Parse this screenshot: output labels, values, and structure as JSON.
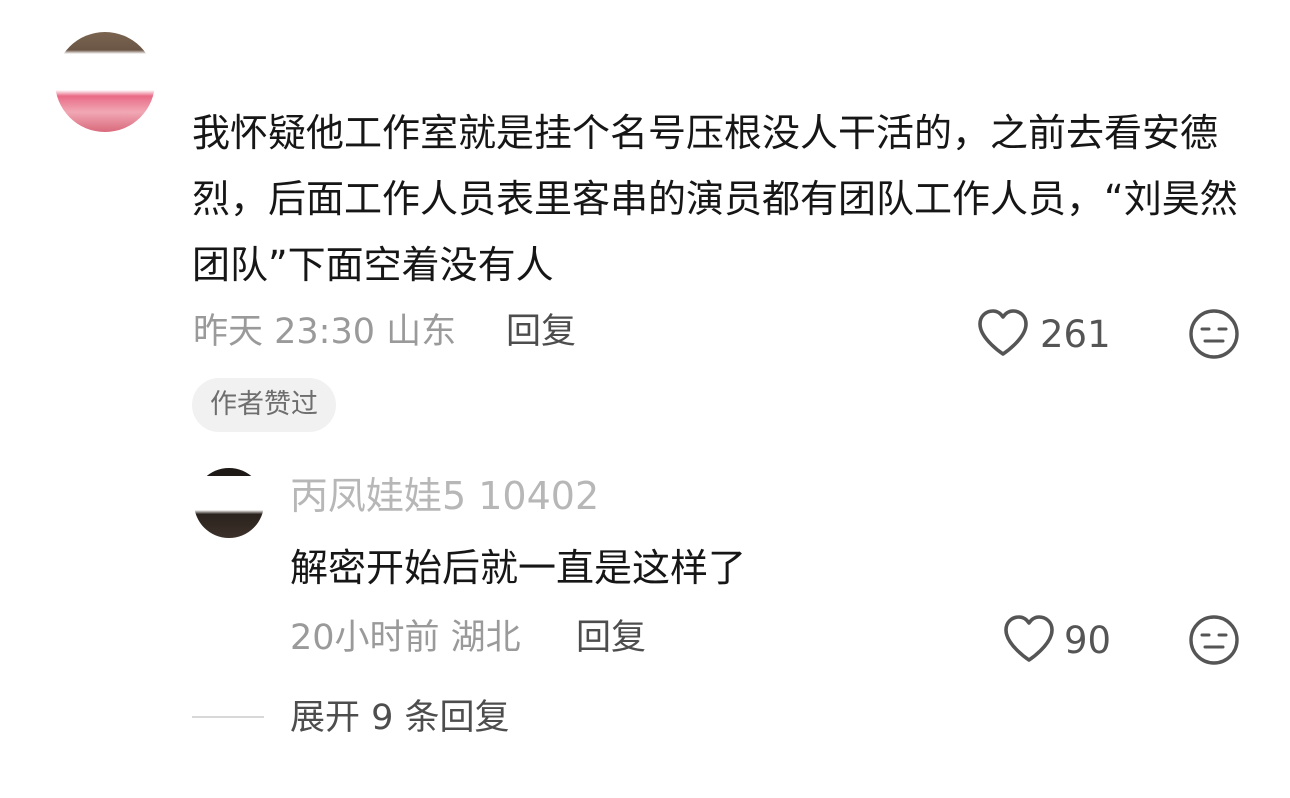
{
  "comment": {
    "username": "",
    "text": "我怀疑他工作室就是挂个名号压根没人干活的，之前去看安德烈，后面工作人员表里客串的演员都有团队工作人员，“刘昊然团队”下面空着没有人",
    "meta": "昨天 23:30 山东",
    "reply_label": "回复",
    "likes": "261",
    "author_badge": "作者赞过"
  },
  "reply": {
    "username": "丙凤娃娃5 10402",
    "text": "解密开始后就一直是这样了",
    "meta": "20小时前 湖北",
    "reply_label": "回复",
    "likes": "90"
  },
  "expand_replies_label": "展开 9 条回复",
  "icons": {
    "like": "heart-outline-icon",
    "dislike": "neutral-face-icon"
  },
  "colors": {
    "text": "#161616",
    "meta": "#9a9a9a",
    "icon": "#555555",
    "badge_bg": "#f1f1f1"
  }
}
